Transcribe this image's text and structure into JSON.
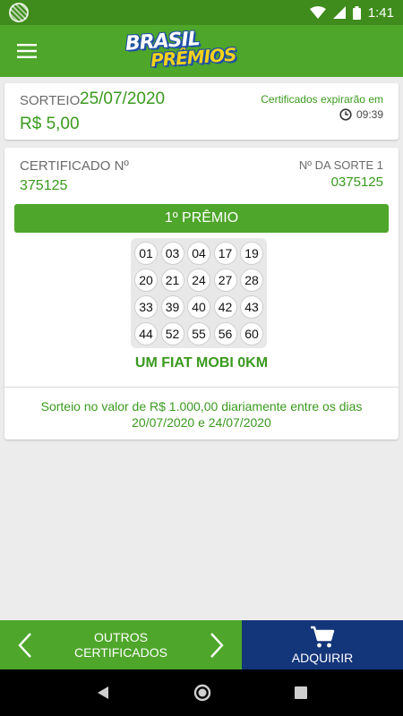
{
  "status_bar": {
    "time": "1:41"
  },
  "app_bar": {
    "logo_line1": "BRASIL",
    "logo_line2": "PRÊMIOS"
  },
  "summary": {
    "sorteio_label": "SORTEIO",
    "sorteio_date": "25/07/2020",
    "price": "R$ 5,00",
    "expire_label": "Certificados expirarão em",
    "expire_time": "09:39"
  },
  "certificate": {
    "cert_label": "CERTIFICADO Nº",
    "cert_number": "375125",
    "sorte_label": "Nº DA SORTE 1",
    "sorte_number": "0375125",
    "prize_title": "1º PRÊMIO",
    "numbers": [
      "01",
      "03",
      "04",
      "17",
      "19",
      "20",
      "21",
      "24",
      "27",
      "28",
      "33",
      "39",
      "40",
      "42",
      "43",
      "44",
      "52",
      "55",
      "56",
      "60"
    ],
    "prize_name": "UM FIAT MOBI 0KM",
    "description": "Sorteio no valor de R$ 1.000,00 diariamente entre os dias 20/07/2020 e 24/07/2020"
  },
  "bottom": {
    "outros_label_line1": "OUTROS",
    "outros_label_line2": "CERTIFICADOS",
    "adquirir_label": "ADQUIRIR"
  },
  "colors": {
    "primary_green": "#4ea62a",
    "text_green": "#3a9a1e",
    "navy": "#13357a"
  }
}
